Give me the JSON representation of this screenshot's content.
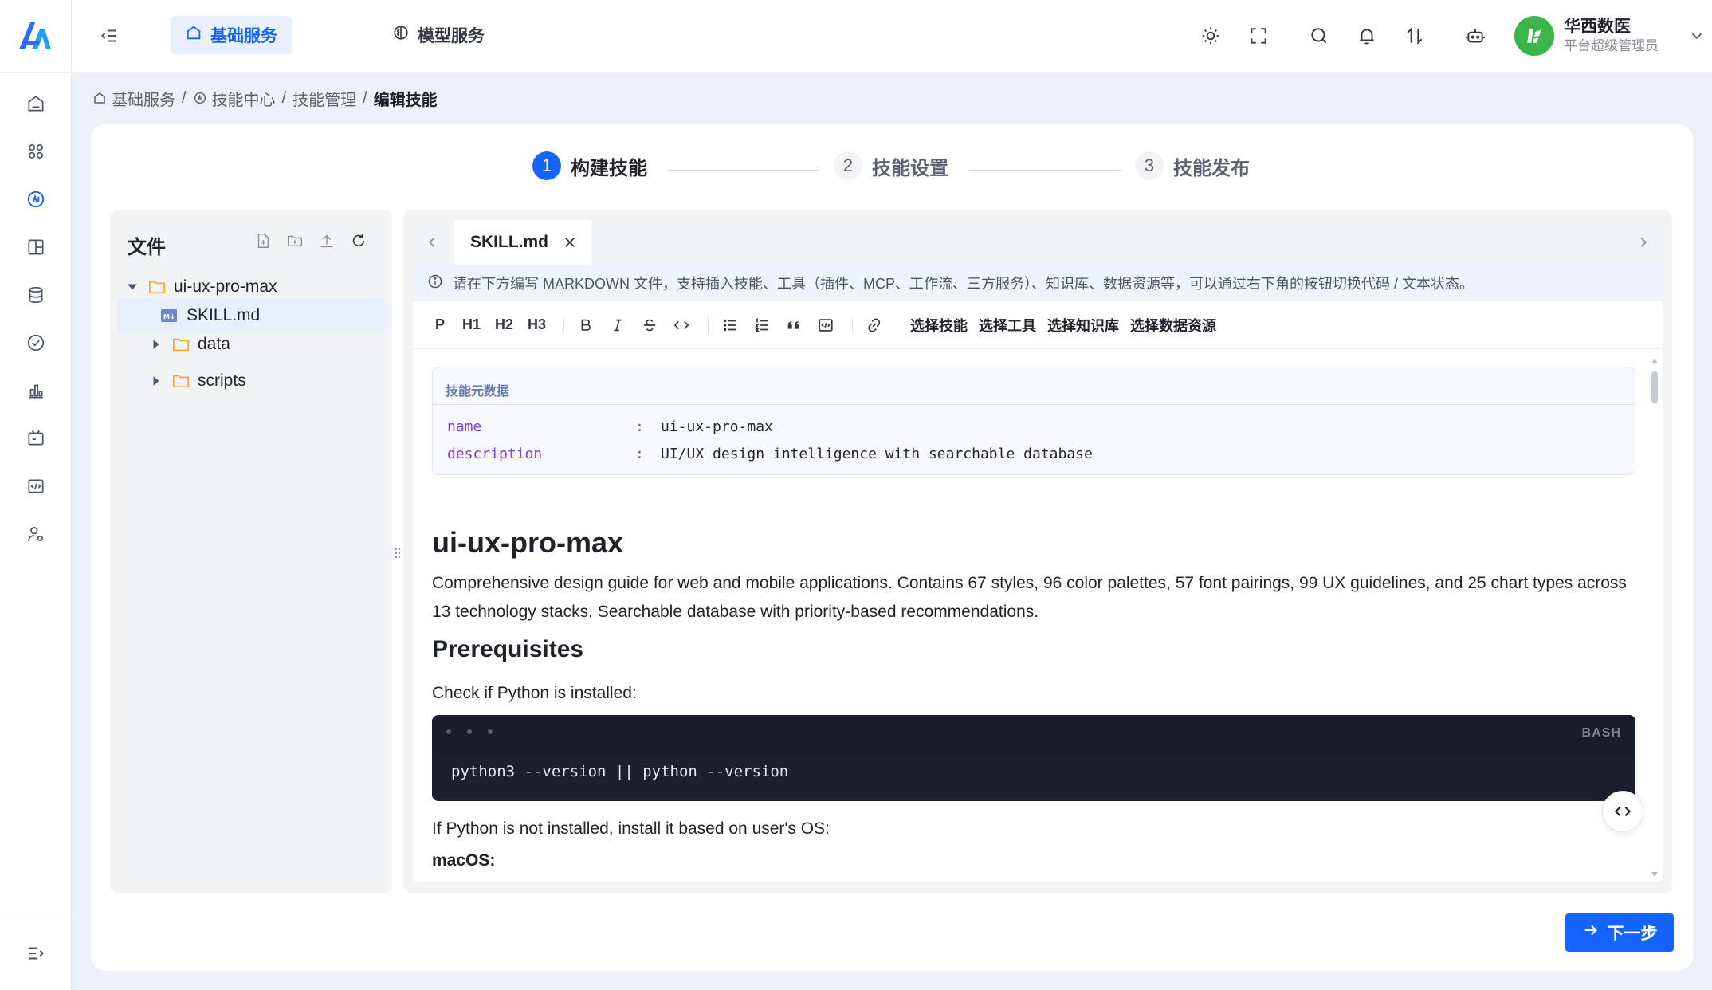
{
  "top_tabs": [
    {
      "label": "基础服务",
      "icon": "home-icon",
      "active": true
    },
    {
      "label": "模型服务",
      "icon": "brain-icon",
      "active": false
    }
  ],
  "header_icons": [
    "sun-icon",
    "fullscreen-icon",
    "search-icon",
    "bell-icon",
    "sort-icon",
    "robot-icon"
  ],
  "user": {
    "name": "华西数医",
    "role": "平台超级管理员"
  },
  "breadcrumb": {
    "items": [
      "基础服务",
      "技能中心",
      "技能管理"
    ],
    "current": "编辑技能",
    "separator": "/"
  },
  "steps": [
    {
      "num": "1",
      "label": "构建技能",
      "status": "active"
    },
    {
      "num": "2",
      "label": "技能设置",
      "status": "todo"
    },
    {
      "num": "3",
      "label": "技能发布",
      "status": "todo"
    }
  ],
  "file_panel": {
    "title": "文件",
    "tree": {
      "root": "ui-ux-pro-max",
      "selected": "SKILL.md",
      "folders": [
        "data",
        "scripts"
      ]
    }
  },
  "editor": {
    "tab_label": "SKILL.md",
    "notice": "请在下方编写 MARKDOWN 文件，支持插入技能、工具（插件、MCP、工作流、三方服务）、知识库、数据资源等，可以通过右下角的按钮切换代码 / 文本状态。",
    "toolbar": {
      "p": "P",
      "h1": "H1",
      "h2": "H2",
      "h3": "H3",
      "select_skill": "选择技能",
      "select_tool": "选择工具",
      "select_kb": "选择知识库",
      "select_data": "选择数据资源"
    },
    "meta": {
      "title": "技能元数据",
      "colon": ":",
      "name_key": "name",
      "name_value": "ui-ux-pro-max",
      "desc_key": "description",
      "desc_value": "UI/UX design intelligence with searchable database"
    },
    "doc": {
      "h1": "ui-ux-pro-max",
      "intro": "Comprehensive design guide for web and mobile applications. Contains 67 styles, 96 color palettes, 57 font pairings, 99 UX guidelines, and 25 chart types across 13 technology stacks. Searchable database with priority-based recommendations.",
      "h2": "Prerequisites",
      "check": "Check if Python is installed:",
      "code_lang": "BASH",
      "code": "python3 --version || python --version",
      "after_code": "If Python is not installed, install it based on user's OS:",
      "h4": "macOS:"
    }
  },
  "next_button": "下一步",
  "colors": {
    "accent": "#1664ff",
    "avatar": "#3bb54a",
    "code_bg": "#1e1f2e"
  }
}
